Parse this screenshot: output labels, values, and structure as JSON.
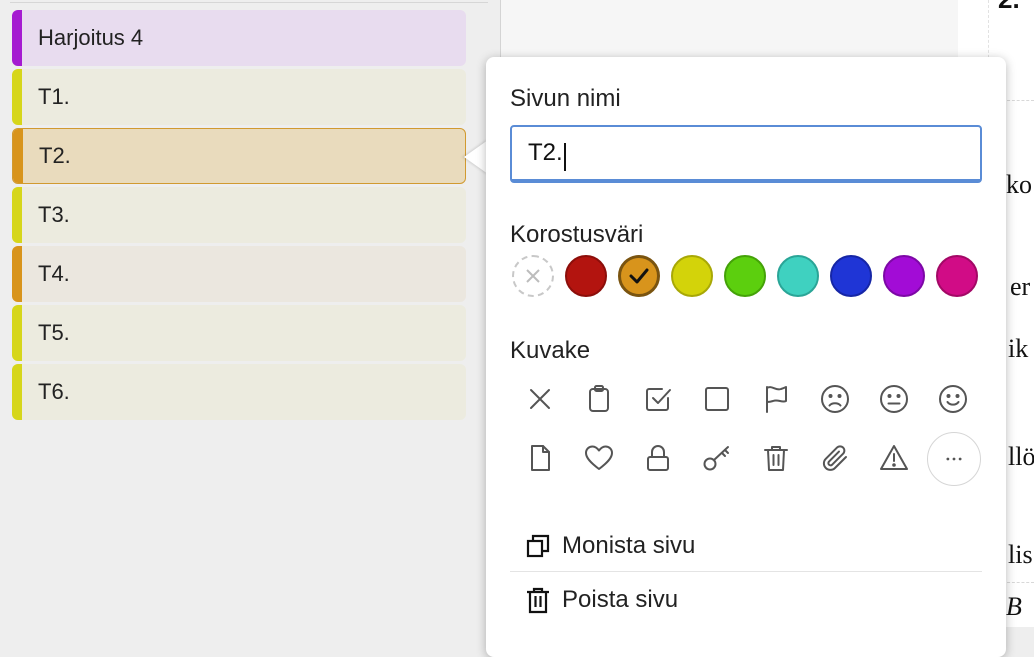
{
  "sidebar": {
    "items": [
      {
        "label": "Harjoitus 4",
        "bg": "#e8dcef",
        "bar": "#a51bd1"
      },
      {
        "label": "T1.",
        "bg": "#ecebdf",
        "bar": "#d6d61a"
      },
      {
        "label": "T2.",
        "bg": "#e9dbbd",
        "bar": "#d8941c"
      },
      {
        "label": "T3.",
        "bg": "#ecebdf",
        "bar": "#d6d61a"
      },
      {
        "label": "T4.",
        "bg": "#ebe7df",
        "bar": "#d8941c"
      },
      {
        "label": "T5.",
        "bg": "#ecebdf",
        "bar": "#d6d61a"
      },
      {
        "label": "T6.",
        "bg": "#ecebdf",
        "bar": "#d6d61a"
      }
    ],
    "selected_index": 2
  },
  "popup": {
    "name_section": {
      "title": "Sivun nimi",
      "value": "T2."
    },
    "color_section": {
      "title": "Korostusväri",
      "colors": [
        {
          "name": "none",
          "hex": "#ffffff"
        },
        {
          "name": "red",
          "hex": "#b3140f"
        },
        {
          "name": "orange",
          "hex": "#d8941c"
        },
        {
          "name": "yellow",
          "hex": "#d3d30a"
        },
        {
          "name": "green",
          "hex": "#5ccf0e"
        },
        {
          "name": "turquoise",
          "hex": "#3fd1c0"
        },
        {
          "name": "blue",
          "hex": "#1f35d6"
        },
        {
          "name": "purple",
          "hex": "#a20cd6"
        },
        {
          "name": "magenta",
          "hex": "#d10c86"
        }
      ],
      "selected": "orange"
    },
    "icon_section": {
      "title": "Kuvake",
      "icons": [
        "x-icon",
        "clipboard-icon",
        "checkbox-checked-icon",
        "checkbox-empty-icon",
        "flag-icon",
        "sad-face-icon",
        "neutral-face-icon",
        "smile-face-icon",
        "file-icon",
        "heart-icon",
        "lock-icon",
        "key-icon",
        "trash-icon",
        "paperclip-icon",
        "warning-icon",
        "more-icon"
      ]
    },
    "actions": {
      "duplicate": "Monista sivu",
      "delete": "Poista sivu"
    }
  },
  "document": {
    "fragments": [
      "2.",
      "ko",
      "er",
      "ik",
      "llö",
      "lis",
      "B"
    ]
  }
}
